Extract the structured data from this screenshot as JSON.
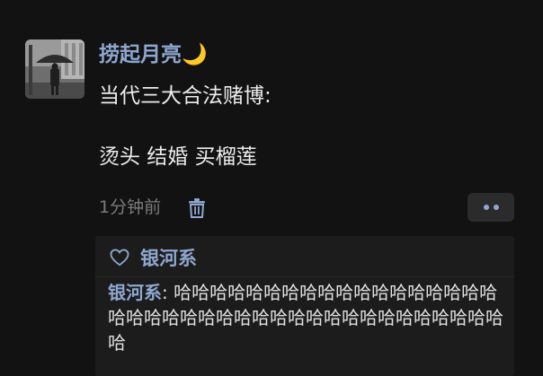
{
  "post": {
    "username": "捞起月亮🌙",
    "text_lines": [
      "当代三大合法赌博:",
      "",
      "烫头 结婚 买榴莲"
    ],
    "timestamp": "1分钟前"
  },
  "icons": {
    "delete": "trash-icon",
    "more": "more-dots-icon",
    "like": "heart-icon"
  },
  "likes": {
    "users": [
      "银河系"
    ]
  },
  "comments": [
    {
      "author": "银河系",
      "separator": ": ",
      "text": "哈哈哈哈哈哈哈哈哈哈哈哈哈哈哈哈哈哈哈哈哈哈哈哈哈哈哈哈哈哈哈哈哈哈哈哈哈哈哈哈哈"
    }
  ],
  "colors": {
    "background": "#121212",
    "name_accent": "#8ea7cf",
    "panel": "#1c1c1c",
    "muted": "#7b7b7b"
  }
}
